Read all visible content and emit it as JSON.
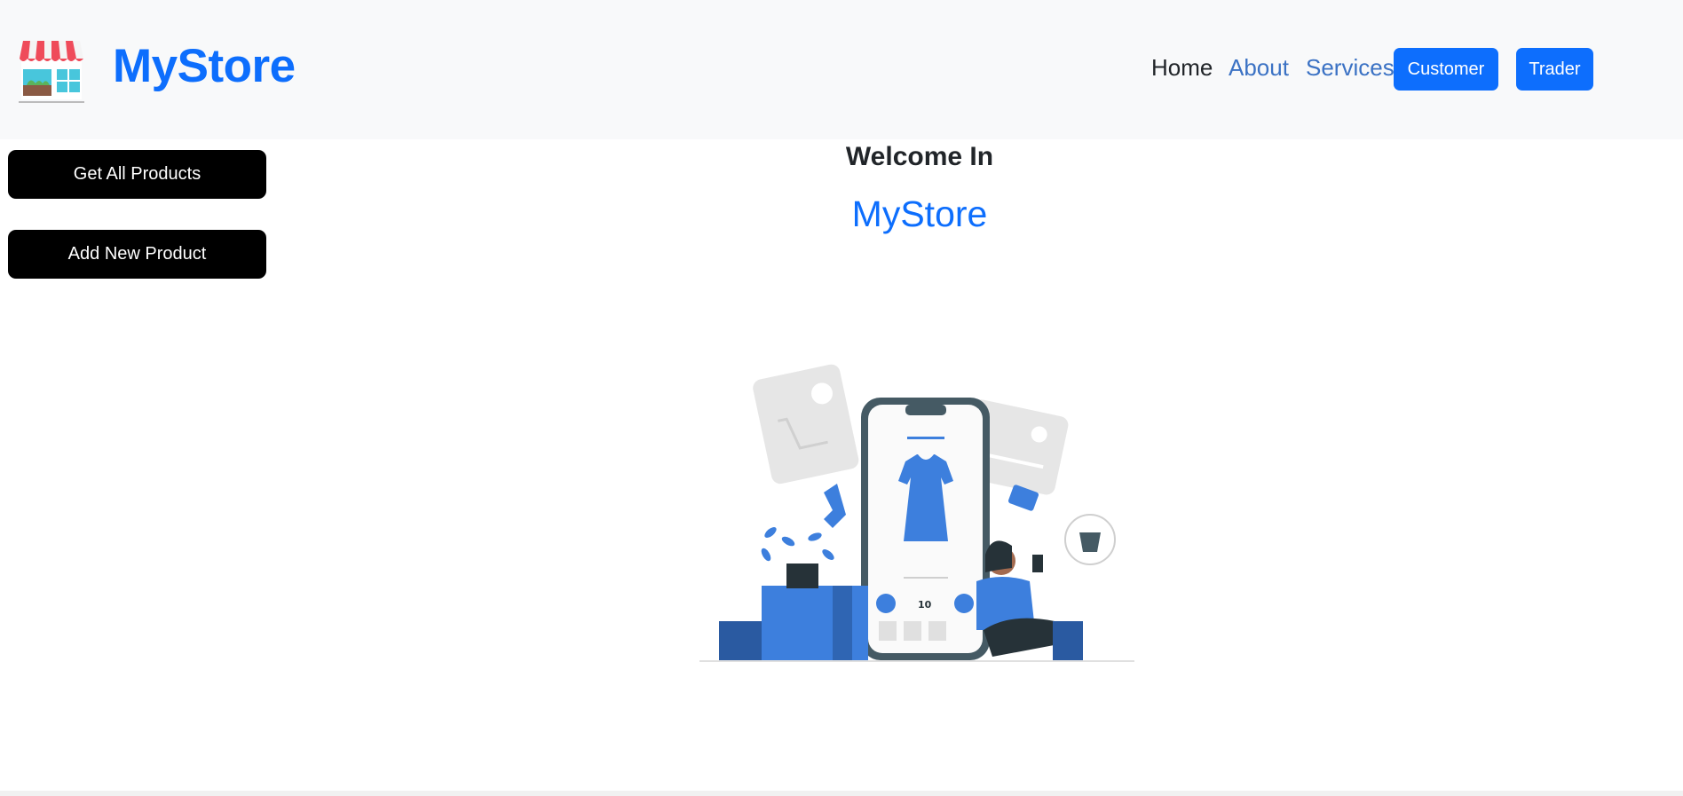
{
  "header": {
    "brand": "MyStore",
    "logo_icon": "storefront-icon",
    "nav": {
      "home": "Home",
      "about": "About",
      "services": "Services"
    },
    "buttons": {
      "customer": "Customer",
      "trader": "Trader"
    }
  },
  "sidebar": {
    "get_all_products": "Get All Products",
    "add_new_product": "Add New Product"
  },
  "main": {
    "welcome": "Welcome In",
    "brand": "MyStore",
    "hero_illustration": "online-shopping-illustration",
    "hero_price": "10"
  },
  "colors": {
    "primary": "#0d6efd",
    "navbar_bg": "#f8f9fa",
    "side_button_bg": "#000000",
    "illustration_blue": "#3d7fdd"
  }
}
